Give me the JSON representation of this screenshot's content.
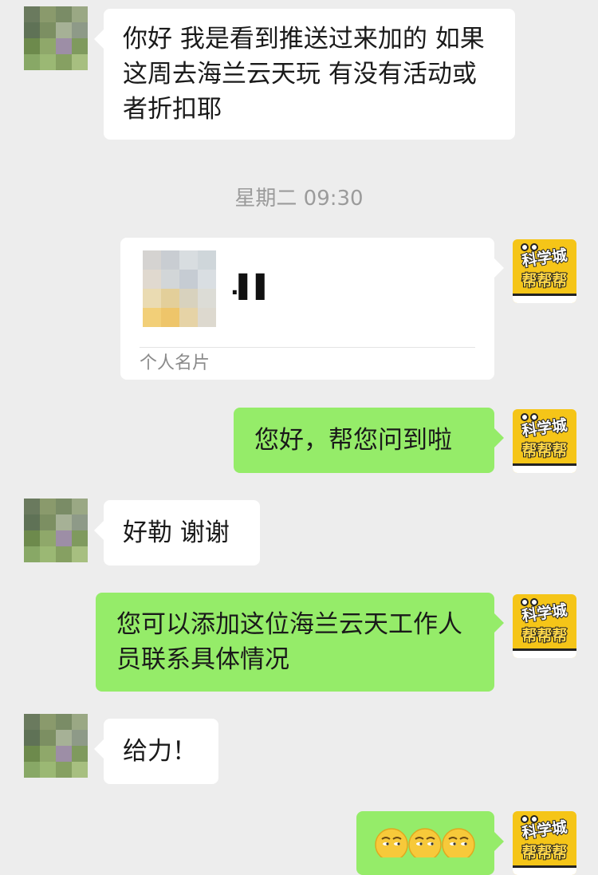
{
  "messages": {
    "m1": {
      "text": "你好 我是看到推送过来加的 如果这周去海兰云天玩 有没有活动或者折扣耶"
    },
    "timestamp": "星期二 09:30",
    "card": {
      "name": ".▌▌",
      "label": "个人名片"
    },
    "m2": {
      "text": "您好，帮您问到啦"
    },
    "m3": {
      "text": "好勒 谢谢"
    },
    "m4": {
      "text": "您可以添加这位海兰云天工作人员联系具体情况"
    },
    "m5": {
      "text": "给力！"
    }
  },
  "me_avatar": {
    "line1": "科学城",
    "line2": "帮帮帮"
  },
  "colors": {
    "background": "#ededed",
    "received_bubble": "#ffffff",
    "sent_bubble": "#95ec69",
    "timestamp": "#9b9b9b"
  },
  "icons": [
    "user-avatar",
    "science-city-logo-avatar",
    "smirk-emoji"
  ]
}
